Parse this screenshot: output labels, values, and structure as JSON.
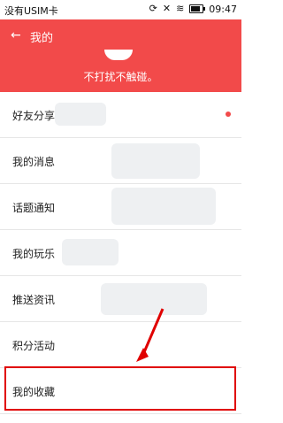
{
  "status_bar": {
    "carrier": "没有USIM卡",
    "time": "09:47",
    "icons": [
      "sync-icon",
      "mute-icon",
      "wifi-icon",
      "battery-icon"
    ]
  },
  "header": {
    "back_icon": "arrow-left-icon",
    "title": "我的",
    "signature": "不打扰不触碰。"
  },
  "menu": {
    "items": [
      {
        "label": "好友分享",
        "has_dot": true
      },
      {
        "label": "我的消息"
      },
      {
        "label": "话题通知"
      },
      {
        "label": "我的玩乐"
      },
      {
        "label": "推送资讯"
      },
      {
        "label": "积分活动"
      },
      {
        "label": "我的收藏"
      }
    ]
  },
  "colors": {
    "header_bg": "#f24a4a",
    "highlight": "#e00000",
    "dot": "#f24a4a"
  }
}
